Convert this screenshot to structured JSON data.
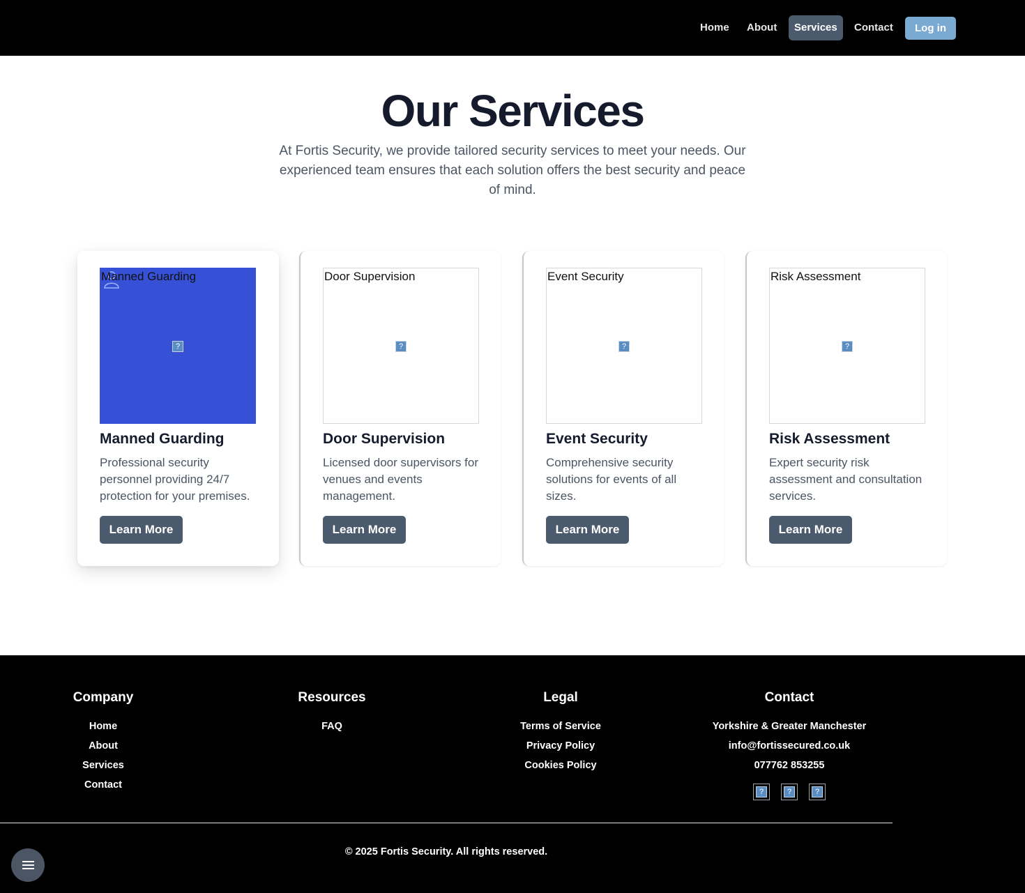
{
  "nav": {
    "links": [
      "Home",
      "About",
      "Services",
      "Contact"
    ],
    "active": "Services",
    "login": "Log in"
  },
  "hero": {
    "title": "Our Services",
    "text": "At Fortis Security, we provide tailored security services to meet your needs. Our experienced team ensures that each solution offers the best security and peace of mind."
  },
  "cards": [
    {
      "alt": "Manned Guarding",
      "title": "Manned Guarding",
      "desc": "Professional security personnel providing 24/7 protection for your premises.",
      "button": "Learn More"
    },
    {
      "alt": "Door Supervision",
      "title": "Door Supervision",
      "desc": "Licensed door supervisors for venues and events management.",
      "button": "Learn More"
    },
    {
      "alt": "Event Security",
      "title": "Event Security",
      "desc": "Comprehensive security solutions for events of all sizes.",
      "button": "Learn More"
    },
    {
      "alt": "Risk Assessment",
      "title": "Risk Assessment",
      "desc": "Expert security risk assessment and consultation services.",
      "button": "Learn More"
    }
  ],
  "colors": {
    "accent": "#4b5a6d",
    "hero_card_bg": "#3651d6",
    "login_bg": "#7aa9d1"
  },
  "footer": {
    "company": {
      "title": "Company",
      "links": [
        "Home",
        "About",
        "Services",
        "Contact"
      ]
    },
    "resources": {
      "title": "Resources",
      "links": [
        "FAQ"
      ]
    },
    "legal": {
      "title": "Legal",
      "links": [
        "Terms of Service",
        "Privacy Policy",
        "Cookies Policy"
      ]
    },
    "contact": {
      "title": "Contact",
      "lines": [
        "Yorkshire & Greater Manchester",
        "info@fortissecured.co.uk",
        "077762 853255"
      ]
    },
    "copyright": "© 2025 Fortis Security. All rights reserved."
  },
  "icons": {
    "broken_image": "?",
    "menu": "menu-icon",
    "person": "person-icon"
  }
}
